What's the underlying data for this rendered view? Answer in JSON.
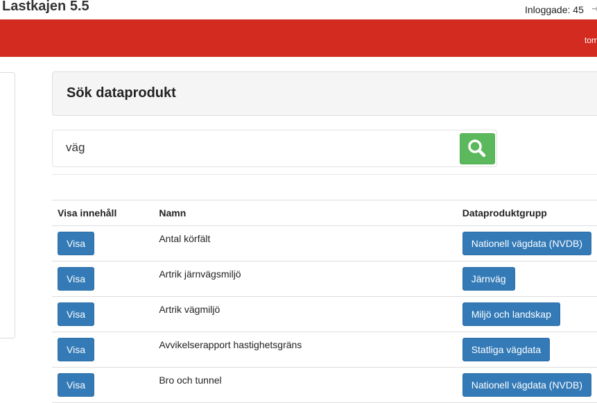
{
  "app": {
    "title": "Lastkajen 5.5",
    "logged_in": "Inloggade: 45",
    "user": "tom"
  },
  "search": {
    "title": "Sök dataprodukt",
    "value": "väg"
  },
  "table": {
    "headers": [
      "Visa innehåll",
      "Namn",
      "Dataproduktgrupp"
    ],
    "rows": [
      {
        "action": "Visa",
        "name": "Antal körfält",
        "group": "Nationell vägdata (NVDB)"
      },
      {
        "action": "Visa",
        "name": "Artrik järnvägsmiljö",
        "group": "Järnväg"
      },
      {
        "action": "Visa",
        "name": "Artrik vägmiljö",
        "group": "Miljö och landskap"
      },
      {
        "action": "Visa",
        "name": "Avvikelserapport hastighetsgräns",
        "group": "Statliga vägdata"
      },
      {
        "action": "Visa",
        "name": "Bro och tunnel",
        "group": "Nationell vägdata (NVDB)"
      }
    ]
  },
  "colors": {
    "header_bar": "#d42b21",
    "primary_button": "#337ab7",
    "search_button": "#5cb85c"
  }
}
